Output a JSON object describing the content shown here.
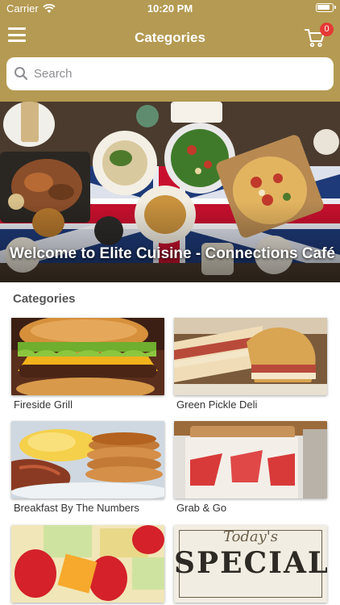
{
  "status_bar": {
    "carrier": "Carrier",
    "time": "10:20 PM"
  },
  "nav": {
    "title": "Categories",
    "cart_count": "0"
  },
  "search": {
    "placeholder": "Search"
  },
  "hero": {
    "caption": "Welcome to Elite Cuisine - Connections Café"
  },
  "categories": {
    "title": "Categories",
    "items": [
      {
        "label": "Fireside Grill"
      },
      {
        "label": "Green Pickle Deli"
      },
      {
        "label": "Breakfast By The Numbers"
      },
      {
        "label": "Grab & Go"
      },
      {
        "label": ""
      },
      {
        "label": ""
      }
    ],
    "special_card": {
      "script_text": "Today's",
      "word": "SPECIAL"
    }
  },
  "colors": {
    "header": "#b49a52",
    "badge": "#e53935"
  }
}
